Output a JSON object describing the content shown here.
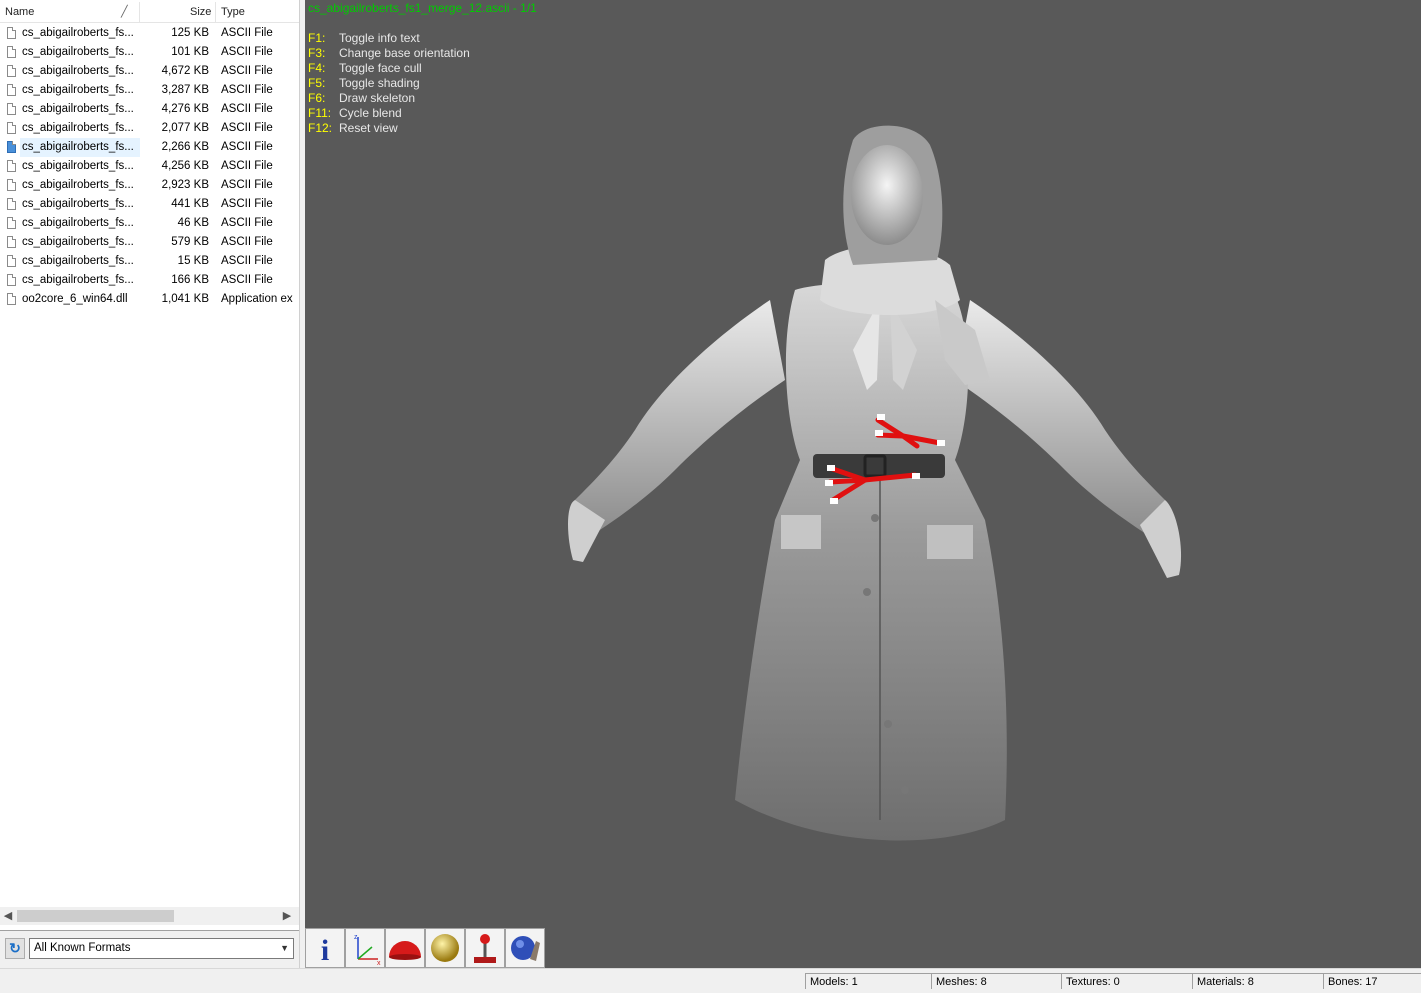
{
  "file_list": {
    "columns": {
      "name": "Name",
      "size": "Size",
      "type": "Type"
    },
    "files": [
      {
        "name": "cs_abigailroberts_fs...",
        "size": "125 KB",
        "type": "ASCII File"
      },
      {
        "name": "cs_abigailroberts_fs...",
        "size": "101 KB",
        "type": "ASCII File"
      },
      {
        "name": "cs_abigailroberts_fs...",
        "size": "4,672 KB",
        "type": "ASCII File"
      },
      {
        "name": "cs_abigailroberts_fs...",
        "size": "3,287 KB",
        "type": "ASCII File"
      },
      {
        "name": "cs_abigailroberts_fs...",
        "size": "4,276 KB",
        "type": "ASCII File"
      },
      {
        "name": "cs_abigailroberts_fs...",
        "size": "2,077 KB",
        "type": "ASCII File"
      },
      {
        "name": "cs_abigailroberts_fs...",
        "size": "2,266 KB",
        "type": "ASCII File"
      },
      {
        "name": "cs_abigailroberts_fs...",
        "size": "4,256 KB",
        "type": "ASCII File"
      },
      {
        "name": "cs_abigailroberts_fs...",
        "size": "2,923 KB",
        "type": "ASCII File"
      },
      {
        "name": "cs_abigailroberts_fs...",
        "size": "441 KB",
        "type": "ASCII File"
      },
      {
        "name": "cs_abigailroberts_fs...",
        "size": "46 KB",
        "type": "ASCII File"
      },
      {
        "name": "cs_abigailroberts_fs...",
        "size": "579 KB",
        "type": "ASCII File"
      },
      {
        "name": "cs_abigailroberts_fs...",
        "size": "15 KB",
        "type": "ASCII File"
      },
      {
        "name": "cs_abigailroberts_fs...",
        "size": "166 KB",
        "type": "ASCII File"
      },
      {
        "name": "oo2core_6_win64.dll",
        "size": "1,041 KB",
        "type": "Application ex"
      }
    ],
    "selected_index": 6
  },
  "format_filter": {
    "value": "All Known Formats"
  },
  "viewport": {
    "title": "cs_abigailroberts_fs1_merge_12.ascii - 1/1",
    "title_color": "#00cc00",
    "key_color": "#ffff00",
    "shortcuts": [
      {
        "key": "F1:",
        "desc": "Toggle info text"
      },
      {
        "key": "F3:",
        "desc": "Change base orientation"
      },
      {
        "key": "F4:",
        "desc": "Toggle face cull"
      },
      {
        "key": "F5:",
        "desc": "Toggle shading"
      },
      {
        "key": "F6:",
        "desc": "Draw skeleton"
      },
      {
        "key": "F11:",
        "desc": "Cycle blend"
      },
      {
        "key": "F12:",
        "desc": "Reset view"
      }
    ]
  },
  "toolbar": {
    "buttons": [
      "info-icon",
      "axes-icon",
      "red-dome-icon",
      "gold-sphere-icon",
      "joystick-icon",
      "globe-hand-icon"
    ]
  },
  "status": {
    "models": "Models: 1",
    "meshes": "Meshes: 8",
    "textures": "Textures: 0",
    "materials": "Materials: 8",
    "bones": "Bones: 17"
  }
}
